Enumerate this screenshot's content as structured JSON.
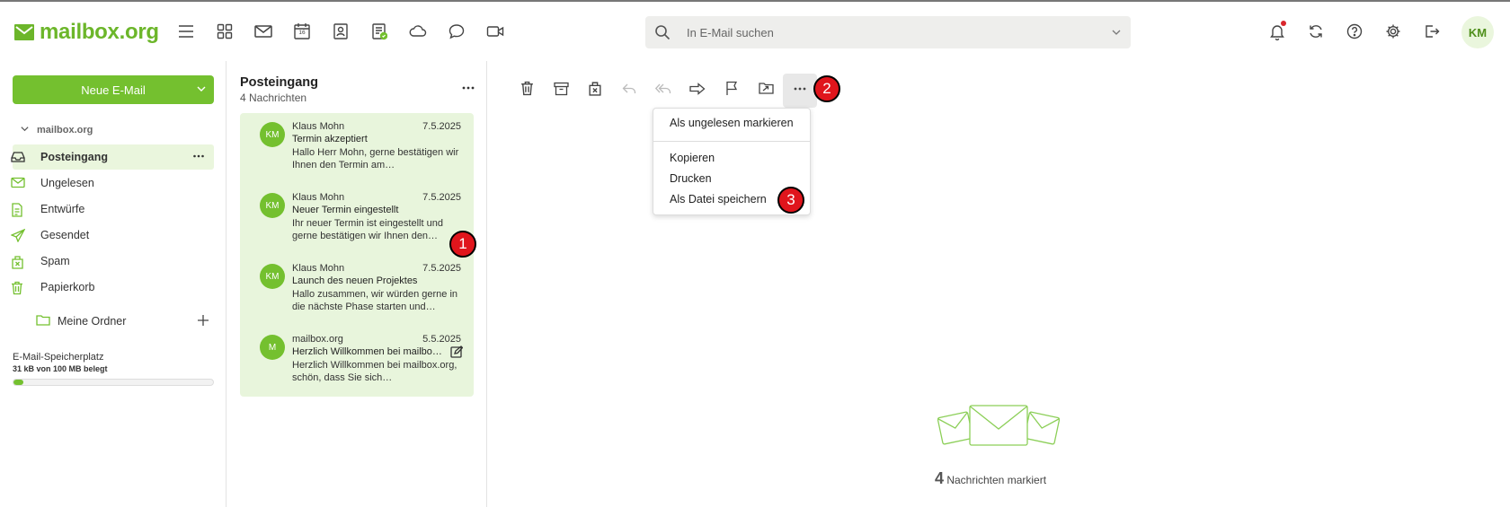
{
  "header": {
    "logo_text": "mailbox.org",
    "search_placeholder": "In E-Mail suchen",
    "avatar_initials": "KM",
    "calendar_day": "16"
  },
  "sidebar": {
    "new_mail_label": "Neue E-Mail",
    "account_label": "mailbox.org",
    "folders": [
      {
        "label": "Posteingang",
        "icon": "inbox-icon",
        "active": true
      },
      {
        "label": "Ungelesen",
        "icon": "envelope-icon"
      },
      {
        "label": "Entwürfe",
        "icon": "draft-icon"
      },
      {
        "label": "Gesendet",
        "icon": "send-icon"
      },
      {
        "label": "Spam",
        "icon": "spam-icon"
      },
      {
        "label": "Papierkorb",
        "icon": "trash-icon"
      }
    ],
    "my_folders_label": "Meine Ordner",
    "storage_title": "E-Mail-Speicherplatz",
    "storage_used": "31 kB von 100 MB belegt",
    "storage_fraction": 0.05
  },
  "list": {
    "title": "Posteingang",
    "count": "4 Nachrichten",
    "messages": [
      {
        "initials": "KM",
        "from": "Klaus Mohn",
        "date": "7.5.2025",
        "subject": "Termin akzeptiert",
        "preview": "Hallo Herr Mohn, gerne bestätigen wir Ihnen den Termin am…"
      },
      {
        "initials": "KM",
        "from": "Klaus Mohn",
        "date": "7.5.2025",
        "subject": "Neuer Termin eingestellt",
        "preview": "Ihr neuer Termin ist eingestellt und gerne bestätigen wir Ihnen den…"
      },
      {
        "initials": "KM",
        "from": "Klaus Mohn",
        "date": "7.5.2025",
        "subject": "Launch des neuen Projektes",
        "preview": "Hallo zusammen, wir würden gerne in die nächste Phase starten und…"
      },
      {
        "initials": "M",
        "from": "mailbox.org",
        "date": "5.5.2025",
        "subject": "Herzlich Willkommen bei mailbox.org",
        "preview": "Herzlich Willkommen bei mailbox.org, schön, dass Sie sich…"
      }
    ]
  },
  "menu": {
    "items": [
      "Als ungelesen markieren",
      "Kopieren",
      "Drucken",
      "Als Datei speichern"
    ]
  },
  "badges": [
    "1",
    "2",
    "3"
  ],
  "empty": {
    "count": "4",
    "label": "Nachrichten markiert"
  },
  "colors": {
    "brand": "#74c02f",
    "badge": "#e0151c",
    "selection": "#e8f5dc"
  }
}
